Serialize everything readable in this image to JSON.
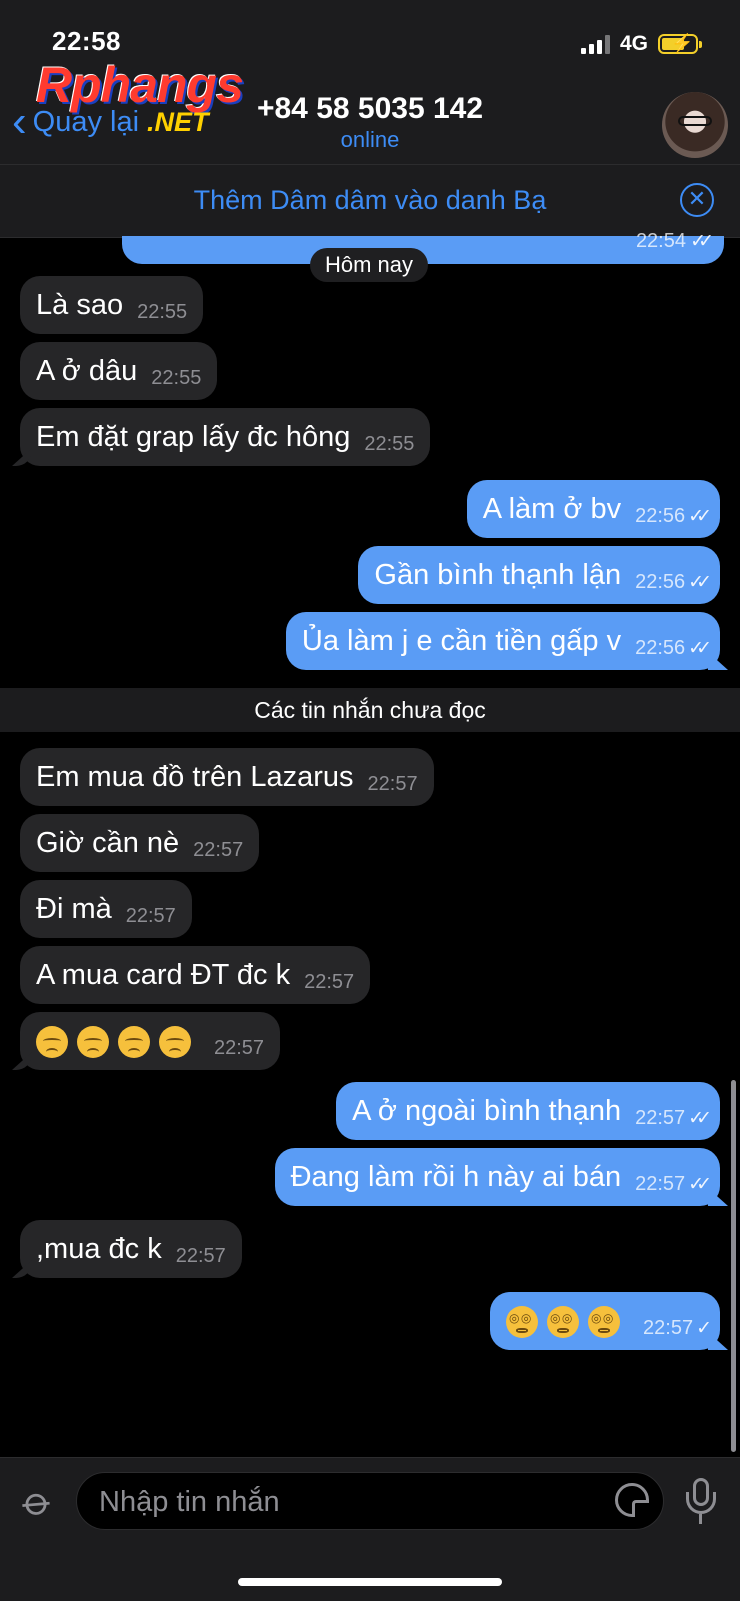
{
  "status": {
    "time": "22:58",
    "network": "4G"
  },
  "watermark": {
    "brand": "Rphangs",
    "suffix": ".NET"
  },
  "header": {
    "back_label": "Quay lại",
    "contact_name": "+84 58 5035 142",
    "contact_status": "online"
  },
  "banner": {
    "text": "Thêm Dâm dâm vào danh Bạ"
  },
  "partial_message": {
    "time": "22:54",
    "ticks": "✓✓"
  },
  "date_separator": "Hôm nay",
  "unread_separator": "Các tin nhắn chưa đọc",
  "messages": [
    {
      "dir": "in",
      "text": "Là sao",
      "time": "22:55"
    },
    {
      "dir": "in",
      "text": "A ở dâu",
      "time": "22:55"
    },
    {
      "dir": "in",
      "text": "Em đặt grap lấy đc hông",
      "time": "22:55"
    },
    {
      "dir": "out",
      "text": "A làm ở bv",
      "time": "22:56",
      "ticks": "✓✓"
    },
    {
      "dir": "out",
      "text": "Gần bình thạnh lận",
      "time": "22:56",
      "ticks": "✓✓"
    },
    {
      "dir": "out",
      "text": "Ủa làm j e cần tiền gấp v",
      "time": "22:56",
      "ticks": "✓✓"
    },
    {
      "dir": "in",
      "text": "Em mua đồ trên Lazarus",
      "time": "22:57"
    },
    {
      "dir": "in",
      "text": "Giờ cần nè",
      "time": "22:57"
    },
    {
      "dir": "in",
      "text": "Đi mà",
      "time": "22:57"
    },
    {
      "dir": "in",
      "text": "A mua card ĐT đc k",
      "time": "22:57"
    },
    {
      "dir": "in",
      "text": "",
      "time": "22:57",
      "emoji": "pensive-face-emoji"
    },
    {
      "dir": "out",
      "text": "A ở ngoài bình thạnh",
      "time": "22:57",
      "ticks": "✓✓"
    },
    {
      "dir": "out",
      "text": "Đang làm rồi h này ai bán",
      "time": "22:57",
      "ticks": "✓✓"
    },
    {
      "dir": "in",
      "text": ",mua đc k",
      "time": "22:57"
    },
    {
      "dir": "out",
      "text": "",
      "time": "22:57",
      "ticks": "✓",
      "emoji": "dizzy-face-emoji"
    }
  ],
  "input": {
    "placeholder": "Nhập tin nhắn"
  },
  "colors": {
    "accent": "#3d8cf5",
    "outgoing_bubble": "#5a9cf5",
    "incoming_bubble": "#262628",
    "background": "#000000"
  }
}
